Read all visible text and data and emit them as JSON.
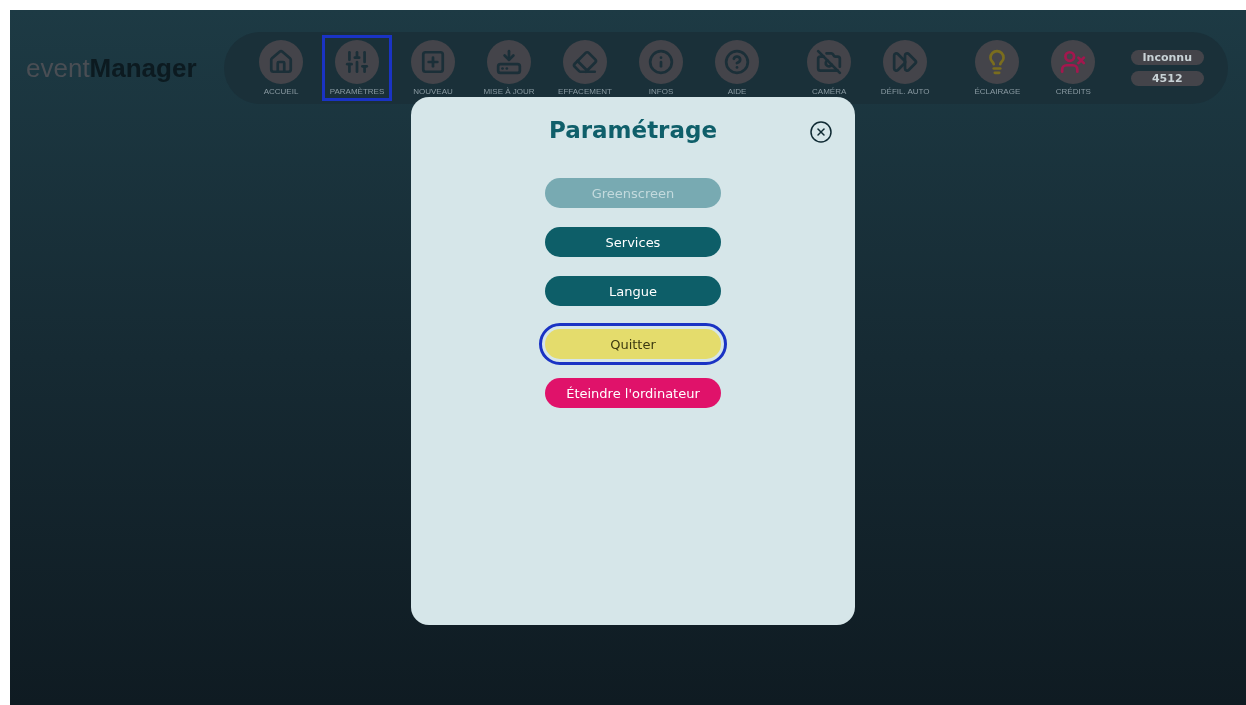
{
  "logo": {
    "light": "event",
    "bold": "Manager"
  },
  "toolbar": [
    {
      "label": "ACCUEIL",
      "selected": false,
      "color": "#1b2f38"
    },
    {
      "label": "PARAMÈTRES",
      "selected": true,
      "color": "#1b2f38"
    },
    {
      "label": "NOUVEAU",
      "selected": false,
      "color": "#1b2f38"
    },
    {
      "label": "MISE À JOUR",
      "selected": false,
      "color": "#1b2f38"
    },
    {
      "label": "EFFACEMENT",
      "selected": false,
      "color": "#1b2f38"
    },
    {
      "label": "INFOS",
      "selected": false,
      "color": "#1b2f38"
    },
    {
      "label": "AIDE",
      "selected": false,
      "color": "#1b2f38"
    },
    {
      "label": "CAMÉRA",
      "selected": false,
      "color": "#1b2f38"
    },
    {
      "label": "DÉFIL. AUTO",
      "selected": false,
      "color": "#1b2f38"
    },
    {
      "label": "ÉCLAIRAGE",
      "selected": false,
      "color": "#7a6d1e"
    },
    {
      "label": "CRÉDITS",
      "selected": false,
      "color": "#a3174e"
    }
  ],
  "user": {
    "name": "Inconnu",
    "code": "4512"
  },
  "dialog": {
    "title": "Paramétrage",
    "buttons": [
      {
        "label": "Greenscreen",
        "kind": "disabled",
        "focused": false
      },
      {
        "label": "Services",
        "kind": "normal",
        "focused": false
      },
      {
        "label": "Langue",
        "kind": "normal",
        "focused": false
      },
      {
        "label": "Quitter",
        "kind": "quit",
        "focused": true
      },
      {
        "label": "Éteindre l'ordinateur",
        "kind": "shutdown",
        "focused": false
      }
    ]
  }
}
